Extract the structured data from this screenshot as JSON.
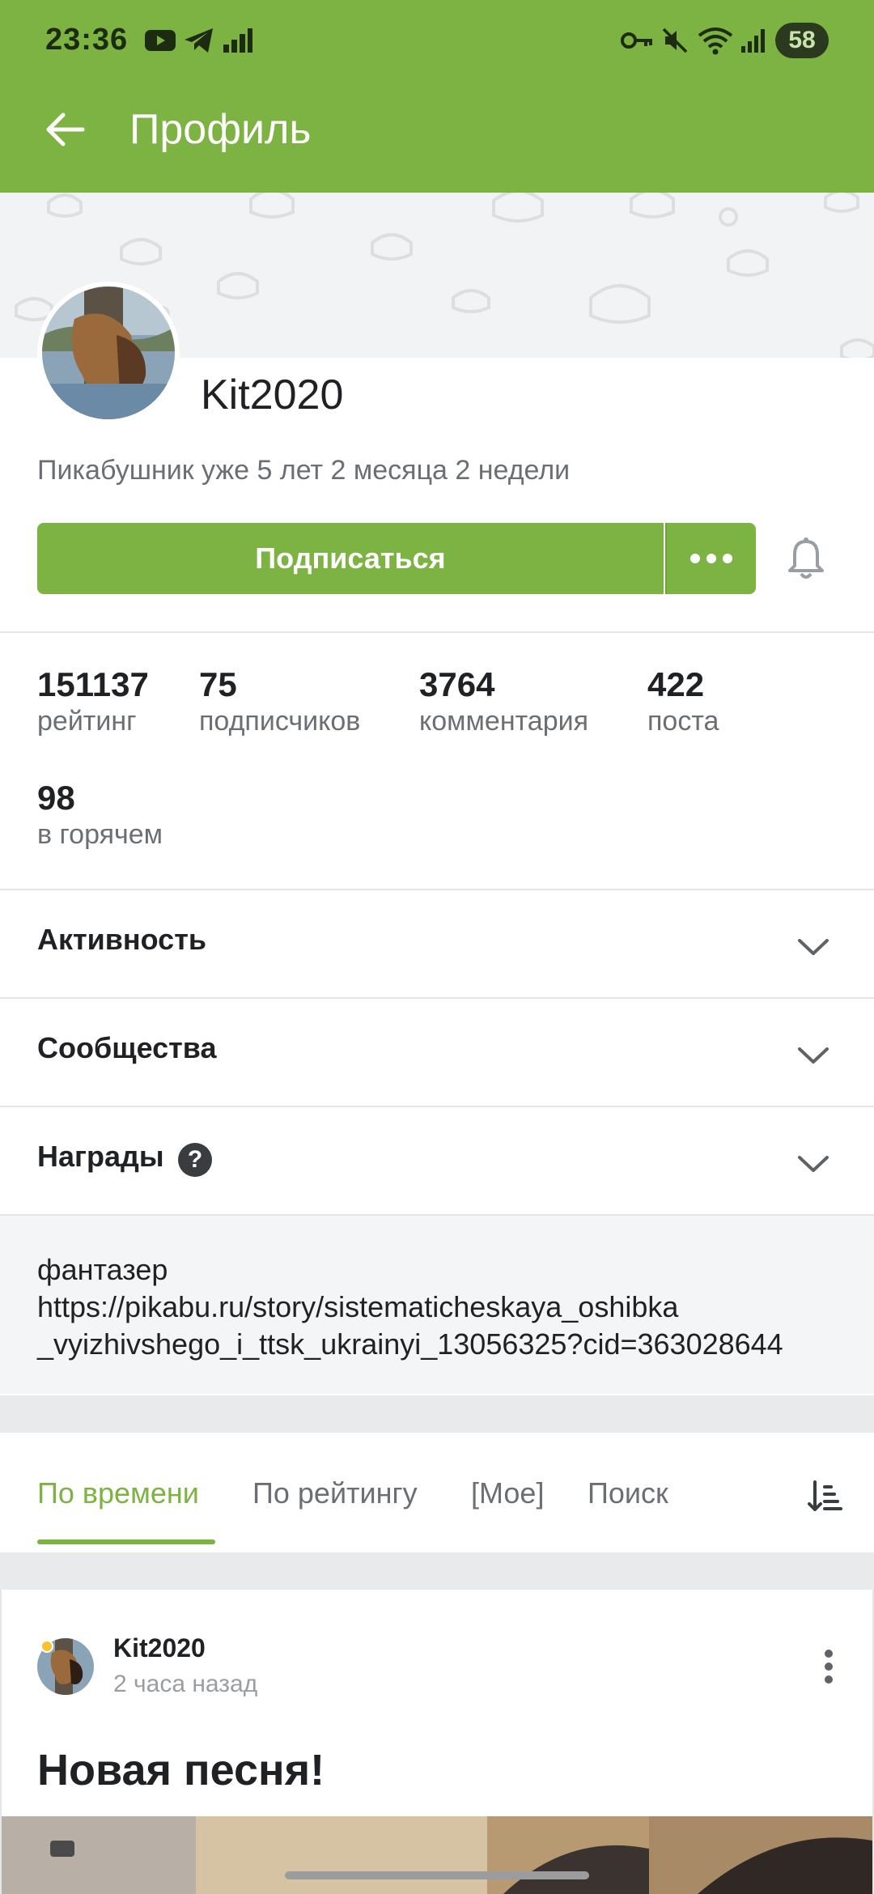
{
  "status_bar": {
    "time": "23:36",
    "battery": "58"
  },
  "app_bar": {
    "title": "Профиль"
  },
  "profile": {
    "username": "Kit2020",
    "member_since": "Пикабушник уже 5 лет 2 месяца 2 недели",
    "subscribe_label": "Подписаться"
  },
  "stats": [
    {
      "value": "151137",
      "label": "рейтинг"
    },
    {
      "value": "75",
      "label": "подписчиков"
    },
    {
      "value": "3764",
      "label": "комментария"
    },
    {
      "value": "422",
      "label": "поста"
    },
    {
      "value": "98",
      "label": "в горячем"
    }
  ],
  "sections": {
    "activity": "Активность",
    "communities": "Сообщества",
    "awards": "Награды",
    "awards_help": "?"
  },
  "about": {
    "line1": "фантазер",
    "line2": "https://pikabu.ru/story/sistematicheskaya_oshibka",
    "line3": "_vyizhivshego_i_ttsk_ukrainyi_13056325?cid=363028644"
  },
  "tabs": {
    "by_time": "По времени",
    "by_rating": "По рейтингу",
    "mine": "[Мое]",
    "search": "Поиск",
    "active_tab": "По времени"
  },
  "post": {
    "author": "Kit2020",
    "time": "2 часа назад",
    "title": "Новая песня!"
  },
  "colors": {
    "accent": "#7cb342",
    "text": "#1f2124",
    "muted": "#6b6f74"
  },
  "icons": {
    "back": "arrow-left-icon",
    "more": "more-horizontal-icon",
    "bell": "bell-icon",
    "chevron": "chevron-down-icon",
    "sort": "sort-icon",
    "post_menu": "more-vertical-icon"
  }
}
